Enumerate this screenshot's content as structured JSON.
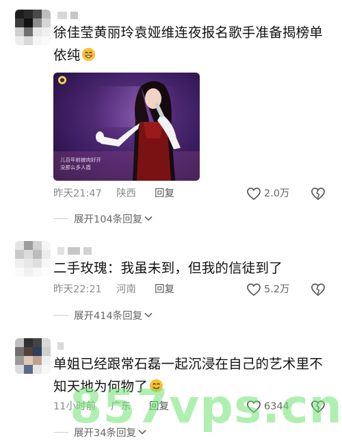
{
  "comments": [
    {
      "text": "徐佳莹黄丽玲袁娅维连夜报名歌手准备揭榜单依纯",
      "image_caption": [
        "儿百年前被肉好开",
        "没那么多人盾"
      ],
      "time": "昨天21:47",
      "region": "陕西",
      "reply_label": "回复",
      "likes": "2.0万",
      "expand_label": "展开104条回复"
    },
    {
      "text": "二手玫瑰：我虽未到，但我的信徒到了",
      "time": "昨天22:21",
      "region": "河南",
      "reply_label": "回复",
      "likes": "5.2万",
      "expand_label": "展开414条回复"
    },
    {
      "text": "单姐已经跟常石磊一起沉浸在自己的艺术里不知天地为何物了",
      "time": "11小时前",
      "region": "广东",
      "reply_label": "回复",
      "likes": "6344",
      "expand_label": "展开34条回复"
    }
  ],
  "watermark": "857vps.cn",
  "colors": {
    "meta_text": "#8a8a8a",
    "watermark": "#6ee470",
    "photo_bg": "#3a1a5a"
  },
  "icons": [
    "emoji-smile-icon",
    "heart-outline-icon",
    "broken-heart-icon",
    "chevron-down-icon"
  ]
}
